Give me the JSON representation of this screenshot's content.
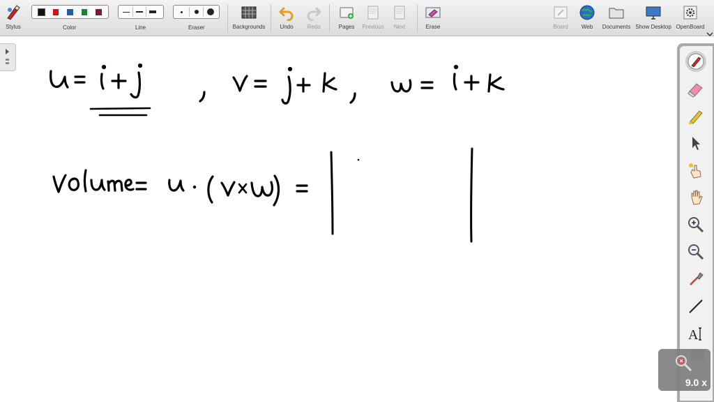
{
  "toolbar": {
    "stylus": "Stylus",
    "color": "Color",
    "line": "Line",
    "eraser": "Eraser",
    "backgrounds": "Backgrounds",
    "undo": "Undo",
    "redo": "Redo",
    "pages": "Pages",
    "previous": "Previous",
    "next": "Next",
    "erase": "Erase",
    "board": "Board",
    "web": "Web",
    "documents": "Documents",
    "show_desktop": "Show Desktop",
    "openboard": "OpenBoard"
  },
  "colors": [
    "#111111",
    "#e01010",
    "#1f5fa8",
    "#138a2a",
    "#8a1040"
  ],
  "zoom": "9.0 x",
  "right_tools": [
    "pen-icon",
    "eraser-icon",
    "highlighter-icon",
    "pointer-icon",
    "laser-pointer-icon",
    "hand-icon",
    "zoom-in-icon",
    "zoom-out-icon",
    "capture-icon",
    "line-icon",
    "text-icon"
  ]
}
